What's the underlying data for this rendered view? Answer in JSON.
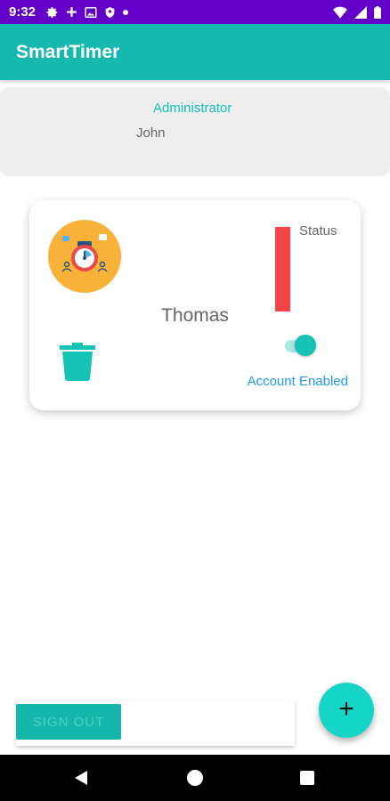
{
  "status_bar": {
    "time": "9:32",
    "left_icons": [
      "gear-icon",
      "plus-icon",
      "image-icon",
      "shield-icon",
      "dot-icon"
    ],
    "right_icons": [
      "wifi-icon",
      "cellular-icon",
      "battery-icon"
    ]
  },
  "app": {
    "title": "SmartTimer"
  },
  "admin": {
    "role": "Administrator",
    "name": "John"
  },
  "user_card": {
    "name": "Thomas",
    "status_label": "Status",
    "status_color": "#f44447",
    "account_status": "Account Enabled",
    "account_enabled": true,
    "avatar_icon": "stopwatch-icon",
    "delete_icon": "trash-icon"
  },
  "actions": {
    "sign_out": "SIGN OUT",
    "fab_symbol": "+"
  },
  "colors": {
    "status_bar": "#6200c9",
    "primary": "#17b8ad",
    "accent": "#14c3b4",
    "link": "#2196f3"
  }
}
